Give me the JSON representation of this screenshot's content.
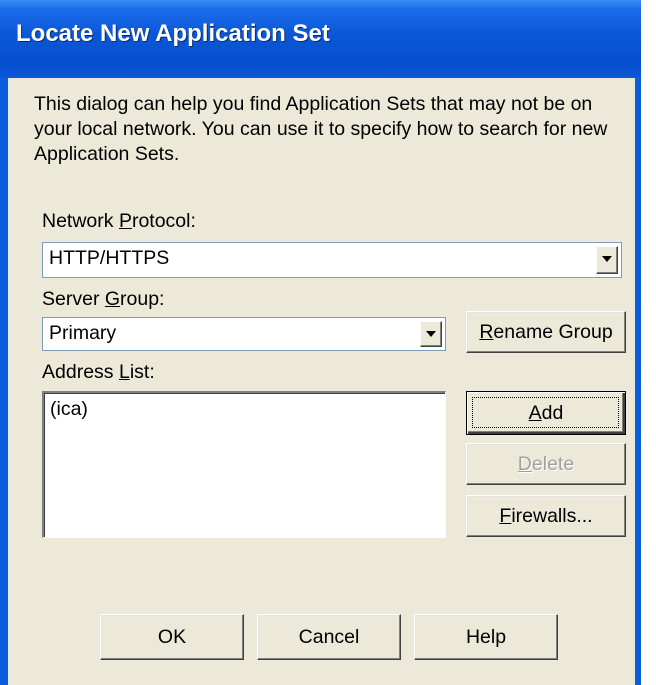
{
  "window": {
    "title": "Locate New Application Set"
  },
  "intro_text": "This dialog can help you find Application Sets that may not be on your local network.  You can use it to specify how to search for new Application Sets.",
  "network_protocol": {
    "label_before": "Network ",
    "label_accel": "P",
    "label_after": "rotocol:",
    "value": "HTTP/HTTPS"
  },
  "server_group": {
    "label_before": "Server ",
    "label_accel": "G",
    "label_after": "roup:",
    "value": "Primary"
  },
  "rename_group_button": {
    "accel": "R",
    "rest": "ename Group"
  },
  "address_list": {
    "label_before": "Address ",
    "label_accel": "L",
    "label_after": "ist:",
    "items": [
      "(ica)"
    ]
  },
  "add_button": {
    "accel": "A",
    "rest": "dd"
  },
  "delete_button": {
    "accel": "D",
    "rest": "elete",
    "enabled": false
  },
  "firewalls_button": {
    "accel": "F",
    "rest": "irewalls..."
  },
  "footer": {
    "ok": "OK",
    "cancel": "Cancel",
    "help": "Help"
  },
  "colors": {
    "titlebar": "#0a57d6",
    "dialog_bg": "#ece9d8"
  }
}
